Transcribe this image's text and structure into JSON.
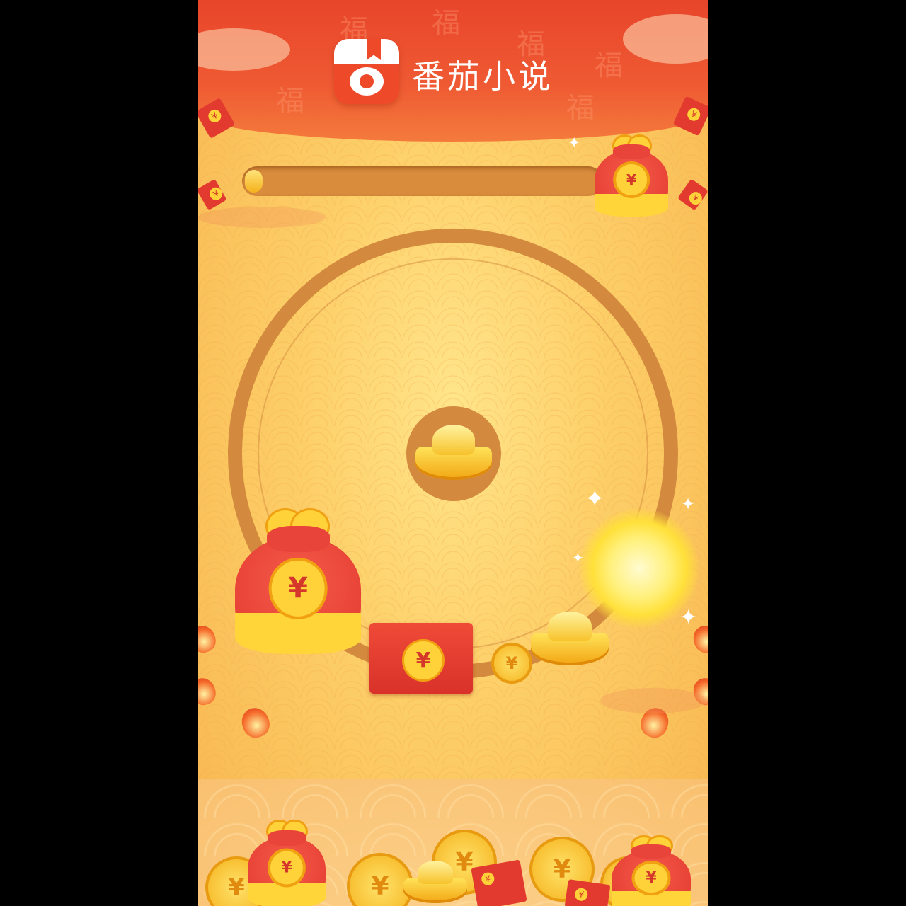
{
  "app": {
    "name": "番茄小说",
    "icon": "tomato-book-icon"
  },
  "progress": {
    "value_fraction": 0.05,
    "goal_icon": "money-bag-icon"
  },
  "currency_symbol": "¥",
  "colors": {
    "header_red": "#e8452a",
    "background_gold": "#fdd06a",
    "ring_brown": "#d48a3e",
    "coin_gold": "#ffd23a",
    "envelope_red": "#e33a2f"
  },
  "board": {
    "center_item": "gold-ingot-icon",
    "items": [
      "money-bag-icon",
      "red-envelope-icon",
      "coin-icon",
      "gold-ingot-icon",
      "sparkle-burst-icon"
    ]
  }
}
